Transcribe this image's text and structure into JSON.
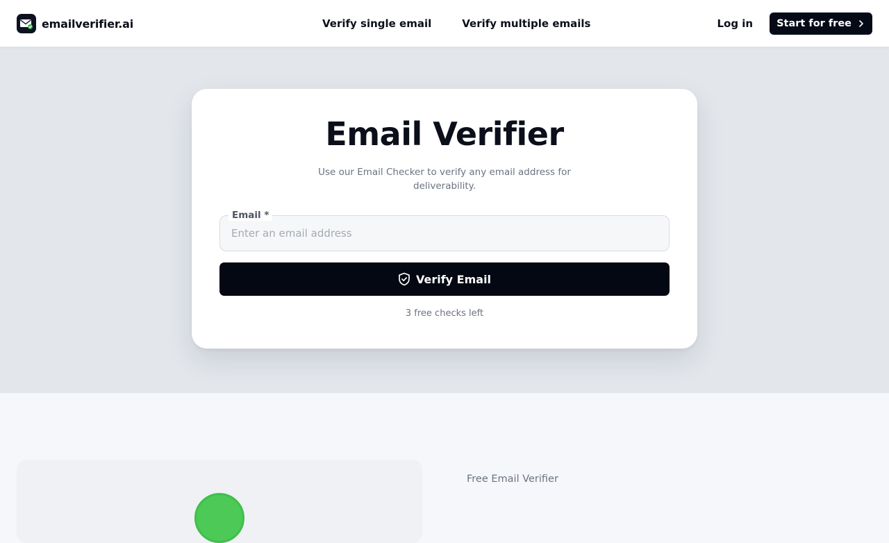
{
  "header": {
    "brand_name": "emailverifier.ai",
    "logo_icon": "envelope-check-icon",
    "nav": [
      {
        "label": "Verify single email"
      },
      {
        "label": "Verify multiple emails"
      }
    ],
    "login_label": "Log in",
    "cta_label": "Start for free",
    "cta_icon": "chevron-right-icon"
  },
  "hero": {
    "title": "Email Verifier",
    "subtitle": "Use our Email Checker to verify any email address for deliverability.",
    "email_field": {
      "label": "Email *",
      "placeholder": "Enter an email address",
      "value": ""
    },
    "verify_button": {
      "label": "Verify Email",
      "icon": "shield-check-icon"
    },
    "checks_left": "3 free checks left"
  },
  "lower": {
    "eyebrow": "Free Email Verifier"
  },
  "colors": {
    "primary_dark": "#040812",
    "hero_background": "#e3e7ec",
    "page_background": "#f5f7fb",
    "success_green": "#4cc957"
  }
}
